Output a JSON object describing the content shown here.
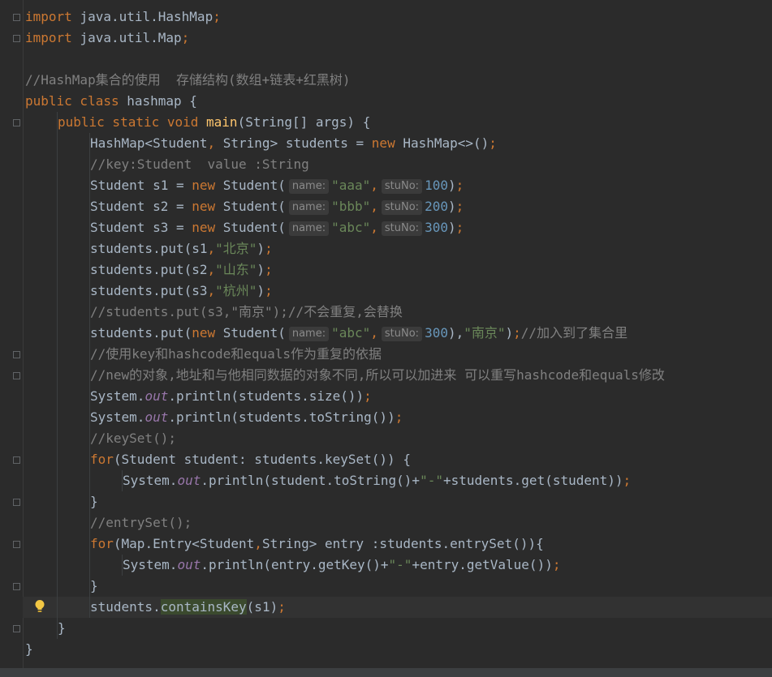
{
  "editor": {
    "lines": [
      {
        "indent": 0,
        "tokens": [
          [
            "kw",
            "import "
          ],
          [
            "",
            "java.util.HashMap"
          ],
          [
            "kw",
            ";"
          ]
        ]
      },
      {
        "indent": 0,
        "tokens": [
          [
            "kw",
            "import "
          ],
          [
            "",
            "java.util.Map"
          ],
          [
            "kw",
            ";"
          ]
        ]
      },
      {
        "indent": 0,
        "tokens": []
      },
      {
        "indent": 0,
        "tokens": [
          [
            "cmt",
            "//HashMap集合的使用  存储结构(数组+链表+红黑树)"
          ]
        ]
      },
      {
        "indent": 0,
        "tokens": [
          [
            "kw",
            "public class "
          ],
          [
            "",
            "hashmap {"
          ]
        ]
      },
      {
        "indent": 1,
        "tokens": [
          [
            "kw",
            "public static void "
          ],
          [
            "fn",
            "main"
          ],
          [
            "",
            "(String[] args) {"
          ]
        ]
      },
      {
        "indent": 2,
        "tokens": [
          [
            "",
            "HashMap<Student"
          ],
          [
            "kw",
            ", "
          ],
          [
            "",
            "String> students = "
          ],
          [
            "kw",
            "new "
          ],
          [
            "",
            "HashMap<>()"
          ],
          [
            "kw",
            ";"
          ]
        ]
      },
      {
        "indent": 2,
        "tokens": [
          [
            "cmt",
            "//key:Student  value :String"
          ]
        ]
      },
      {
        "indent": 2,
        "tokens": [
          [
            "",
            "Student s1 = "
          ],
          [
            "kw",
            "new "
          ],
          [
            "",
            "Student("
          ],
          [
            "hint",
            "name:"
          ],
          [
            "str",
            "\"aaa\""
          ],
          [
            "kw",
            ","
          ],
          [
            "hint",
            "stuNo:"
          ],
          [
            "num",
            "100"
          ],
          [
            "",
            ")"
          ],
          [
            "kw",
            ";"
          ]
        ]
      },
      {
        "indent": 2,
        "tokens": [
          [
            "",
            "Student s2 = "
          ],
          [
            "kw",
            "new "
          ],
          [
            "",
            "Student("
          ],
          [
            "hint",
            "name:"
          ],
          [
            "str",
            "\"bbb\""
          ],
          [
            "kw",
            ","
          ],
          [
            "hint",
            "stuNo:"
          ],
          [
            "num",
            "200"
          ],
          [
            "",
            ")"
          ],
          [
            "kw",
            ";"
          ]
        ]
      },
      {
        "indent": 2,
        "tokens": [
          [
            "",
            "Student s3 = "
          ],
          [
            "kw",
            "new "
          ],
          [
            "",
            "Student("
          ],
          [
            "hint",
            "name:"
          ],
          [
            "str",
            "\"abc\""
          ],
          [
            "kw",
            ","
          ],
          [
            "hint",
            "stuNo:"
          ],
          [
            "num",
            "300"
          ],
          [
            "",
            ")"
          ],
          [
            "kw",
            ";"
          ]
        ]
      },
      {
        "indent": 2,
        "tokens": [
          [
            "",
            "students.put(s1"
          ],
          [
            "kw",
            ","
          ],
          [
            "str",
            "\"北京\""
          ],
          [
            "",
            ")"
          ],
          [
            "kw",
            ";"
          ]
        ]
      },
      {
        "indent": 2,
        "tokens": [
          [
            "",
            "students.put(s2"
          ],
          [
            "kw",
            ","
          ],
          [
            "str",
            "\"山东\""
          ],
          [
            "",
            ")"
          ],
          [
            "kw",
            ";"
          ]
        ]
      },
      {
        "indent": 2,
        "tokens": [
          [
            "",
            "students.put(s3"
          ],
          [
            "kw",
            ","
          ],
          [
            "str",
            "\"杭州\""
          ],
          [
            "",
            ")"
          ],
          [
            "kw",
            ";"
          ]
        ]
      },
      {
        "indent": 2,
        "tokens": [
          [
            "cmt",
            "//students.put(s3,\"南京\");//不会重复,会替换"
          ]
        ]
      },
      {
        "indent": 2,
        "tokens": [
          [
            "",
            "students.put("
          ],
          [
            "kw",
            "new "
          ],
          [
            "",
            "Student("
          ],
          [
            "hint",
            "name:"
          ],
          [
            "str",
            "\"abc\""
          ],
          [
            "kw",
            ","
          ],
          [
            "hint",
            "stuNo:"
          ],
          [
            "num",
            "300"
          ],
          [
            "",
            "),"
          ],
          [
            "str",
            "\"南京\""
          ],
          [
            "",
            ")"
          ],
          [
            "kw",
            ";"
          ],
          [
            "cmt",
            "//加入到了集合里"
          ]
        ]
      },
      {
        "indent": 2,
        "tokens": [
          [
            "cmt",
            "//使用key和hashcode和equals作为重复的依据"
          ]
        ]
      },
      {
        "indent": 2,
        "tokens": [
          [
            "cmt",
            "//new的对象,地址和与他相同数据的对象不同,所以可以加进来 可以重写hashcode和equals修改"
          ]
        ]
      },
      {
        "indent": 2,
        "tokens": [
          [
            "",
            "System."
          ],
          [
            "fld",
            "out"
          ],
          [
            "",
            ".println(students.size())"
          ],
          [
            "kw",
            ";"
          ]
        ]
      },
      {
        "indent": 2,
        "tokens": [
          [
            "",
            "System."
          ],
          [
            "fld",
            "out"
          ],
          [
            "",
            ".println(students.toString())"
          ],
          [
            "kw",
            ";"
          ]
        ]
      },
      {
        "indent": 2,
        "tokens": [
          [
            "cmt",
            "//keySet();"
          ]
        ]
      },
      {
        "indent": 2,
        "tokens": [
          [
            "kw",
            "for"
          ],
          [
            "",
            "(Student student: students.keySet()) {"
          ]
        ]
      },
      {
        "indent": 3,
        "tokens": [
          [
            "",
            "System."
          ],
          [
            "fld",
            "out"
          ],
          [
            "",
            ".println(student.toString()+"
          ],
          [
            "str",
            "\"-\""
          ],
          [
            "",
            "+students.get(student))"
          ],
          [
            "kw",
            ";"
          ]
        ]
      },
      {
        "indent": 2,
        "tokens": [
          [
            "",
            "}"
          ]
        ]
      },
      {
        "indent": 2,
        "tokens": [
          [
            "cmt",
            "//entrySet();"
          ]
        ]
      },
      {
        "indent": 2,
        "tokens": [
          [
            "kw",
            "for"
          ],
          [
            "",
            "(Map.Entry<Student"
          ],
          [
            "kw",
            ","
          ],
          [
            "",
            "String> entry :students.entrySet()){"
          ]
        ]
      },
      {
        "indent": 3,
        "tokens": [
          [
            "",
            "System."
          ],
          [
            "fld",
            "out"
          ],
          [
            "",
            ".println(entry.getKey()+"
          ],
          [
            "str",
            "\"-\""
          ],
          [
            "",
            "+entry.getValue())"
          ],
          [
            "kw",
            ";"
          ]
        ]
      },
      {
        "indent": 2,
        "tokens": [
          [
            "",
            "}"
          ]
        ]
      },
      {
        "indent": 2,
        "tokens": [
          [
            "",
            "students."
          ],
          [
            "hl",
            "containsKey"
          ],
          [
            "",
            "(s1)"
          ],
          [
            "kw",
            ";"
          ]
        ]
      },
      {
        "indent": 1,
        "tokens": [
          [
            "",
            "}"
          ]
        ]
      },
      {
        "indent": 0,
        "tokens": [
          [
            "",
            "}"
          ]
        ]
      }
    ],
    "current_line": 28,
    "fold_markers": [
      0,
      1,
      5,
      16,
      17,
      21,
      23,
      25,
      27,
      29
    ],
    "bulb_line": 28,
    "icons": {
      "bulb": "lightbulb-icon",
      "fold": "fold-marker-icon"
    },
    "colors": {
      "background": "#2b2b2b",
      "text": "#a9b7c6",
      "keyword": "#cc7832",
      "string": "#6a8759",
      "number": "#6897bb",
      "comment": "#808080",
      "method": "#ffc66d",
      "field": "#9876aa"
    }
  }
}
